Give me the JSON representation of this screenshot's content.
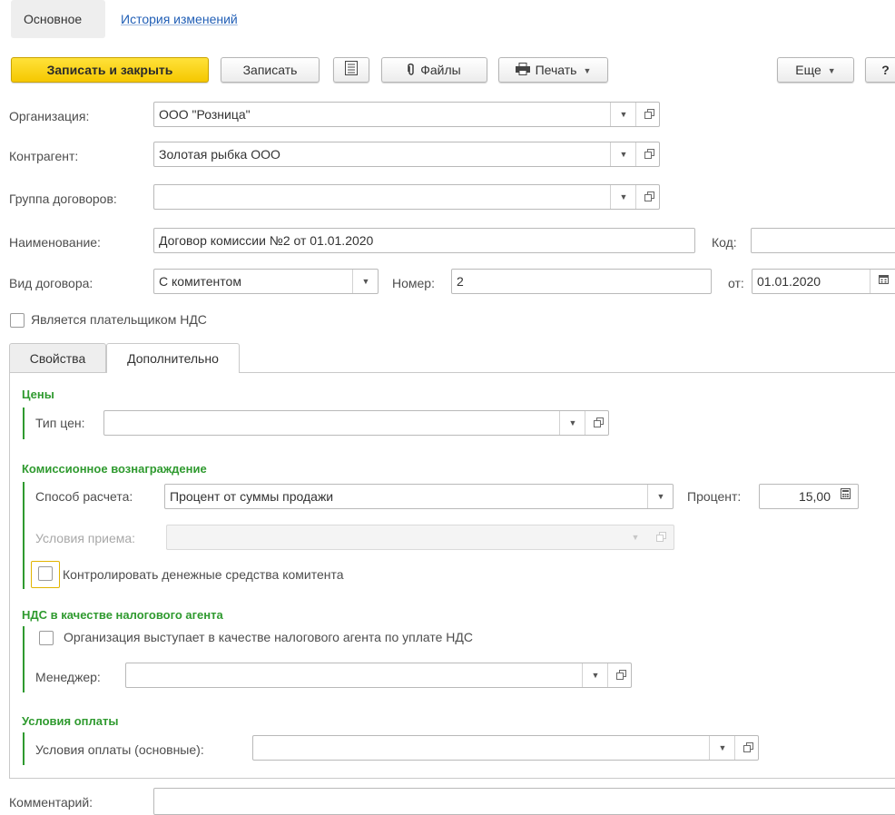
{
  "nav": {
    "main_tab": "Основное",
    "history_link": "История изменений"
  },
  "toolbar": {
    "save_close": "Записать и закрыть",
    "save": "Записать",
    "list_icon": "list-icon",
    "files": "Файлы",
    "files_icon": "paperclip-icon",
    "print": "Печать",
    "print_icon": "printer-icon",
    "more": "Еще",
    "help": "?"
  },
  "header": {
    "organization": {
      "label": "Организация:",
      "value": "ООО \"Розница\""
    },
    "counterparty": {
      "label": "Контрагент:",
      "value": "Золотая рыбка ООО"
    },
    "contract_group": {
      "label": "Группа договоров:",
      "value": ""
    },
    "name": {
      "label": "Наименование:",
      "value": "Договор комиссии №2 от 01.01.2020"
    },
    "code": {
      "label": "Код:",
      "value": ""
    },
    "contract_type": {
      "label": "Вид договора:",
      "value": "С комитентом"
    },
    "number": {
      "label": "Номер:",
      "value": "2"
    },
    "date": {
      "label": "от:",
      "value": "01.01.2020"
    },
    "vat_payer": {
      "label": "Является плательщиком НДС",
      "checked": false
    }
  },
  "tabs": [
    {
      "label": "Свойства",
      "active": false
    },
    {
      "label": "Дополнительно",
      "active": true
    }
  ],
  "prices": {
    "title": "Цены",
    "price_type": {
      "label": "Тип цен:",
      "value": ""
    }
  },
  "commission": {
    "title": "Комиссионное вознаграждение",
    "method": {
      "label": "Способ расчета:",
      "value": "Процент от суммы продажи"
    },
    "percent": {
      "label": "Процент:",
      "value": "15,00"
    },
    "acceptance": {
      "label": "Условия приема:",
      "value": "",
      "disabled": true
    },
    "control_funds": {
      "label": "Контролировать денежные средства комитента",
      "checked": false
    }
  },
  "vat_agent": {
    "title": "НДС в качестве налогового агента",
    "is_agent": {
      "label": "Организация выступает в качестве налогового агента по уплате НДС",
      "checked": false
    },
    "manager": {
      "label": "Менеджер:",
      "value": ""
    }
  },
  "payment": {
    "title": "Условия оплаты",
    "terms": {
      "label": "Условия оплаты (основные):",
      "value": ""
    }
  },
  "comment": {
    "label": "Комментарий:",
    "value": ""
  },
  "colors": {
    "accent_yellow": "#f5c800",
    "group_green": "#2f9a2f",
    "link_blue": "#215fb6"
  }
}
